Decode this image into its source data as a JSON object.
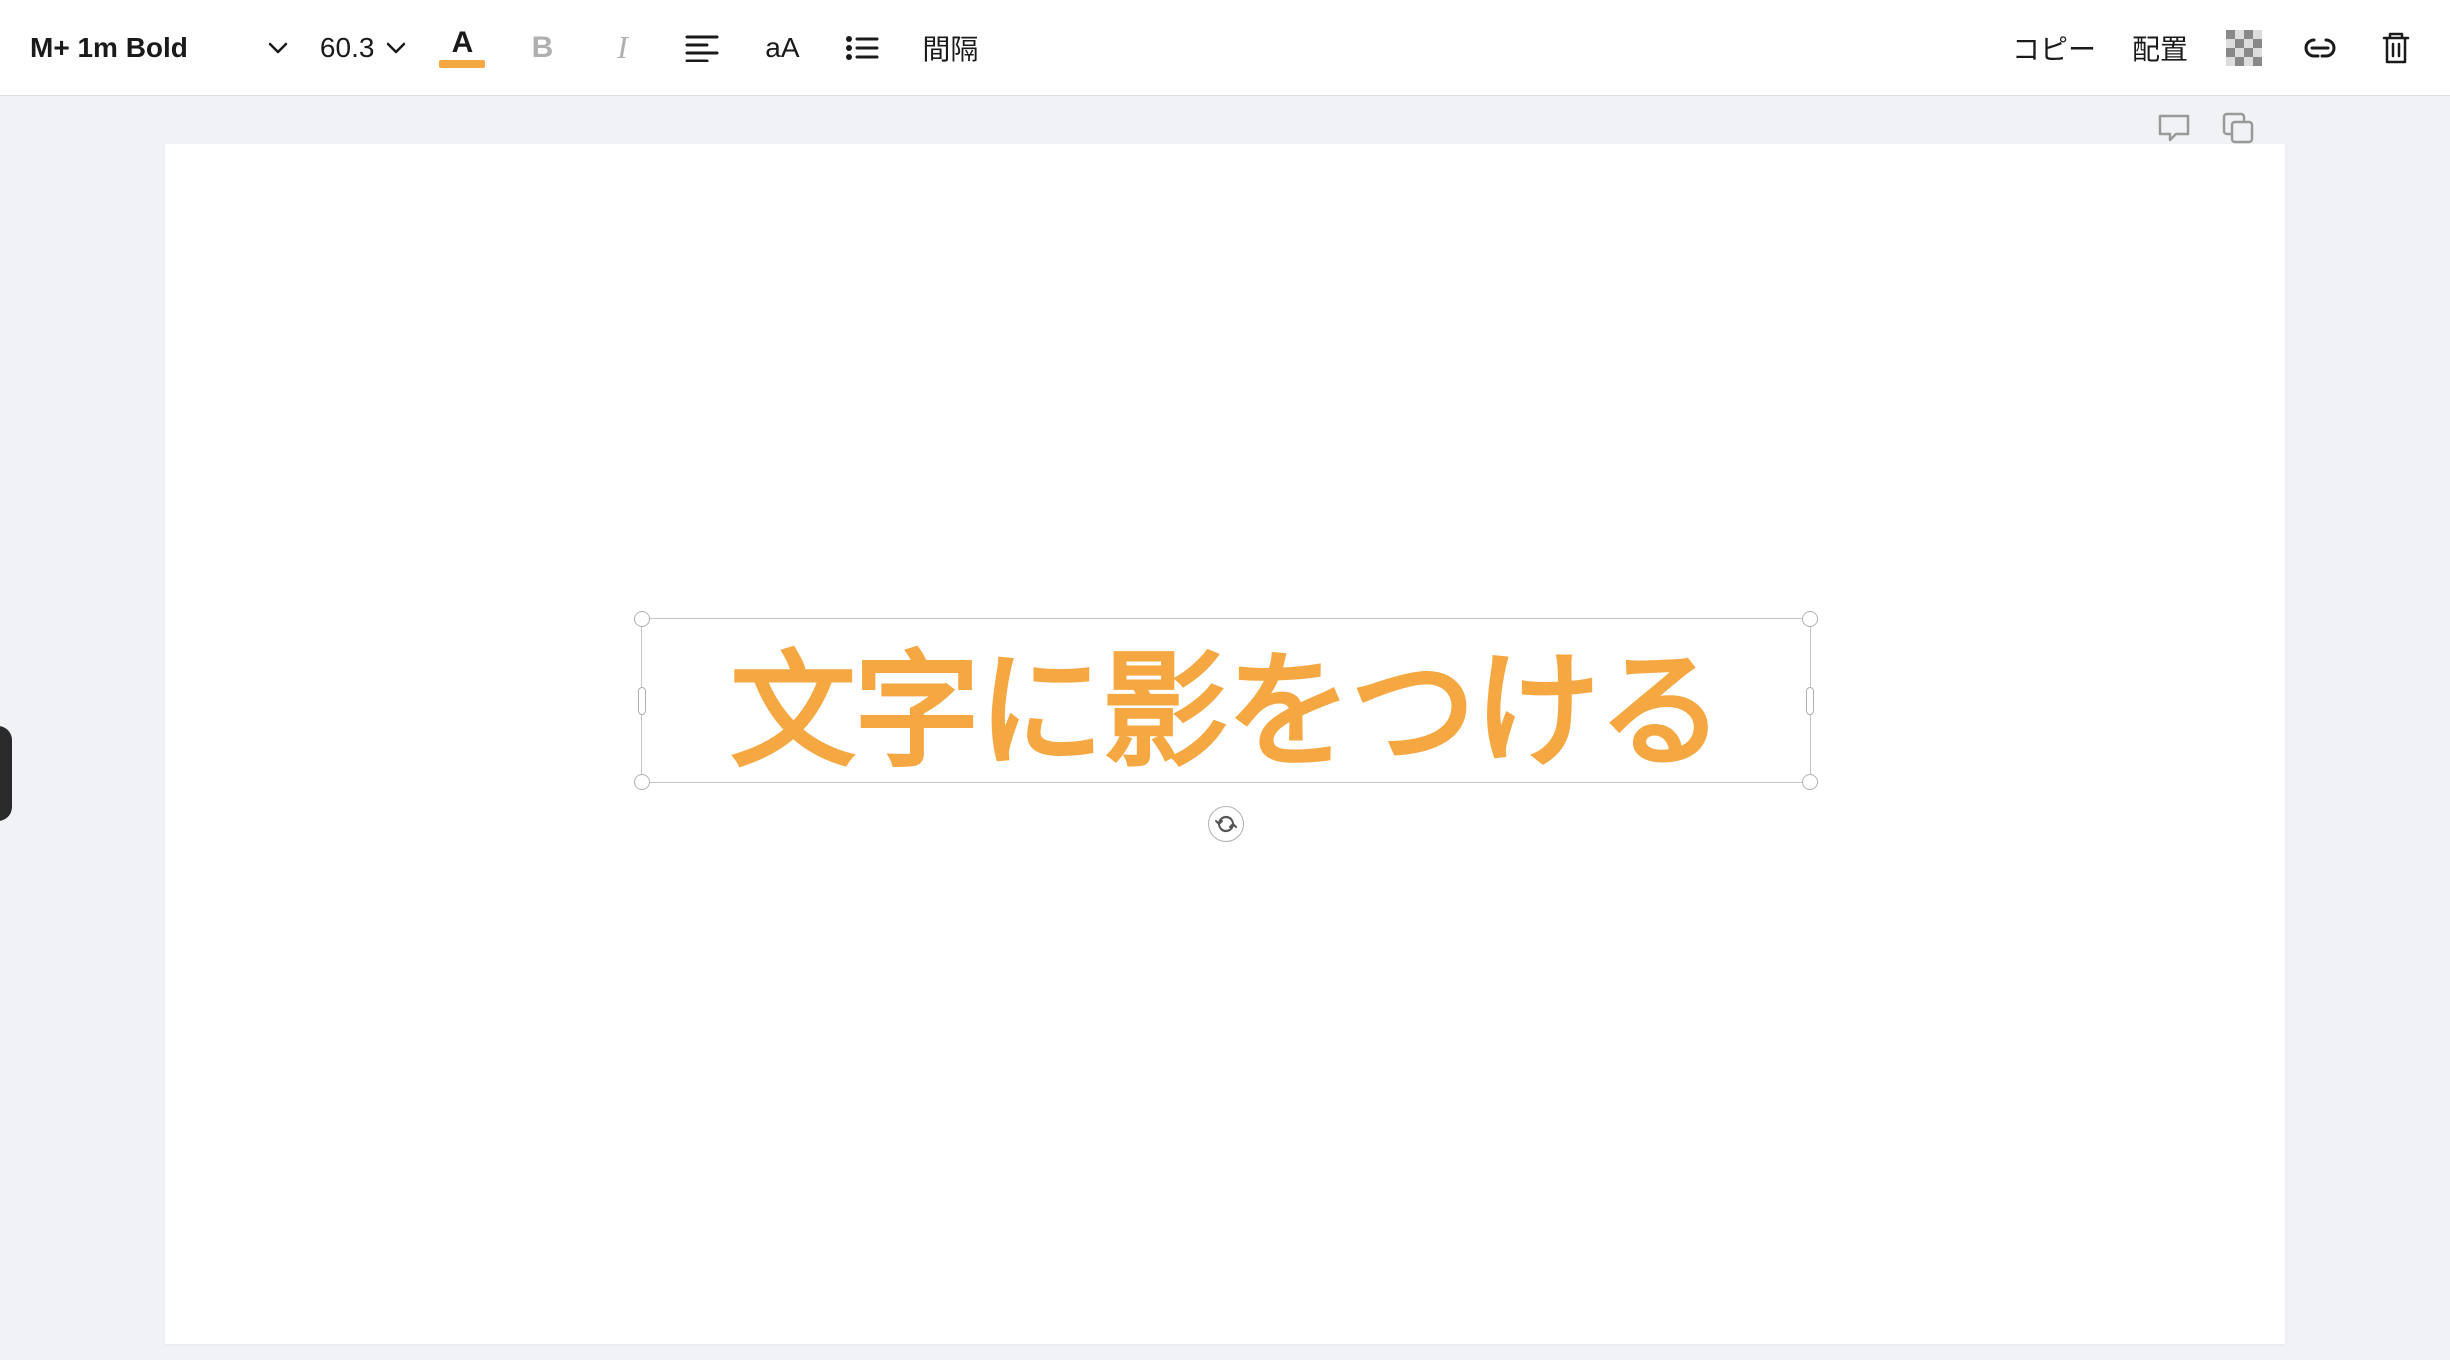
{
  "toolbar": {
    "font_name": "M+ 1m Bold",
    "font_size": "60.3",
    "text_color_letter": "A",
    "text_color_hex": "#f5a742",
    "bold_label": "B",
    "italic_label": "I",
    "case_label": "aA",
    "spacing_label": "間隔",
    "copy_label": "コピー",
    "position_label": "配置"
  },
  "canvas": {
    "text_content": "文字に影をつける",
    "text_color": "#f5a742"
  }
}
